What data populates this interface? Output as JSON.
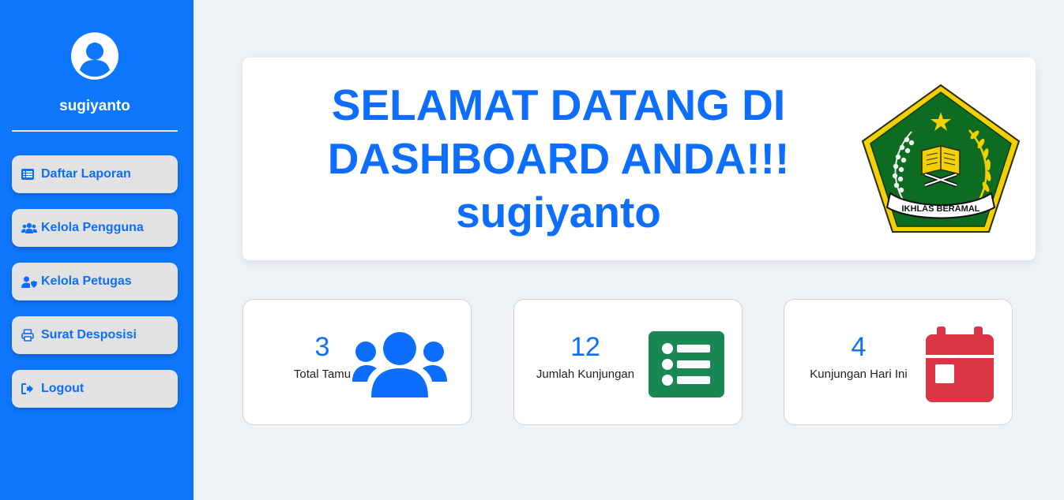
{
  "sidebar": {
    "username": "sugiyanto",
    "items": [
      {
        "label": "Daftar Laporan",
        "icon": "list-icon"
      },
      {
        "label": "Kelola Pengguna",
        "icon": "users-icon"
      },
      {
        "label": "Kelola Petugas",
        "icon": "user-shield-icon"
      },
      {
        "label": "Surat Desposisi",
        "icon": "printer-icon"
      },
      {
        "label": "Logout",
        "icon": "logout-icon"
      }
    ]
  },
  "welcome": {
    "line1": "SELAMAT DATANG DI",
    "line2": "DASHBOARD ANDA!!!",
    "username": "sugiyanto",
    "logo_text": "IKHLAS BERAMAL"
  },
  "stats": [
    {
      "value": "3",
      "label": "Total Tamu",
      "icon": "users-icon",
      "color": "#0d6efd"
    },
    {
      "value": "12",
      "label": "Jumlah Kunjungan",
      "icon": "list-icon",
      "color": "#198754"
    },
    {
      "value": "4",
      "label": "Kunjungan Hari Ini",
      "icon": "calendar-icon",
      "color": "#dc3545"
    }
  ],
  "colors": {
    "sidebar": "#0d76fb",
    "accent": "#0d6efd",
    "background": "#eef1f6"
  }
}
